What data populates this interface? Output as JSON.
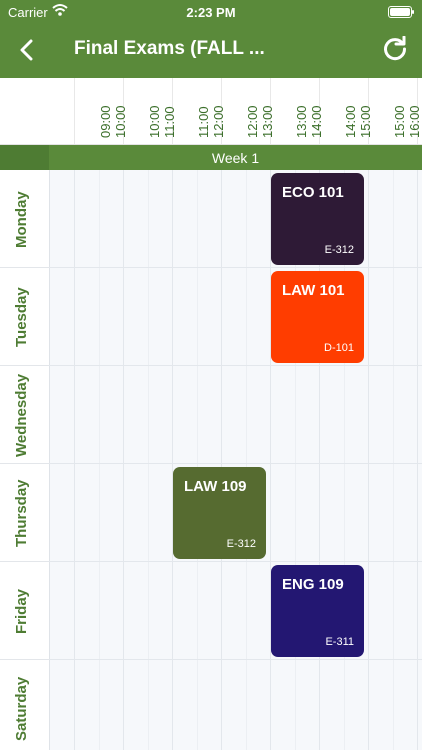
{
  "status_bar": {
    "carrier": "Carrier",
    "time": "2:23 PM"
  },
  "header": {
    "title": "Final Exams (FALL ..."
  },
  "time_slots": [
    {
      "start": "09:00",
      "end": "10:00"
    },
    {
      "start": "10:00",
      "end": "11:00"
    },
    {
      "start": "11:00",
      "end": "12:00"
    },
    {
      "start": "12:00",
      "end": "13:00"
    },
    {
      "start": "13:00",
      "end": "14:00"
    },
    {
      "start": "14:00",
      "end": "15:00"
    },
    {
      "start": "15:00",
      "end": "16:00"
    }
  ],
  "week_label": "Week 1",
  "days": [
    "Monday",
    "Tuesday",
    "Wednesday",
    "Thursday",
    "Friday",
    "Saturday"
  ],
  "events": [
    {
      "code": "ECO 101",
      "room": "E-312",
      "color": "#2e1a36"
    },
    {
      "code": "LAW 101",
      "room": "D-101",
      "color": "#ff3d00"
    },
    {
      "code": "LAW 109",
      "room": "E-312",
      "color": "#566b30"
    },
    {
      "code": "ENG 109",
      "room": "E-311",
      "color": "#231772"
    }
  ],
  "colors": {
    "header": "#5a8a3a",
    "accent_text": "#4e7c33"
  }
}
